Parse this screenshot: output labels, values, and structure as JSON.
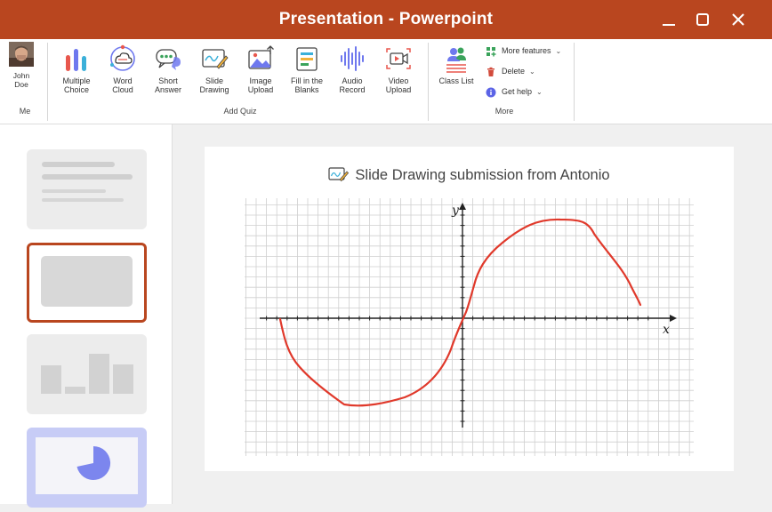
{
  "window": {
    "title": "Presentation - Powerpoint",
    "controls": [
      "minimize",
      "maximize",
      "close"
    ]
  },
  "ribbon": {
    "user": {
      "first_name": "John",
      "last_name": "Doe",
      "group_label": "Me"
    },
    "add_quiz": {
      "group_label": "Add Quiz",
      "tools": [
        {
          "line1": "Multiple",
          "line2": "Choice",
          "icon": "bar-chart-icon"
        },
        {
          "line1": "Word",
          "line2": "Cloud",
          "icon": "word-cloud-icon"
        },
        {
          "line1": "Short",
          "line2": "Answer",
          "icon": "chat-bubbles-icon"
        },
        {
          "line1": "Slide",
          "line2": "Drawing",
          "icon": "slide-drawing-icon"
        },
        {
          "line1": "Image",
          "line2": "Upload",
          "icon": "image-upload-icon"
        },
        {
          "line1": "Fill in the",
          "line2": "Blanks",
          "icon": "fill-blanks-icon"
        },
        {
          "line1": "Audio",
          "line2": "Record",
          "icon": "audio-wave-icon"
        },
        {
          "line1": "Video",
          "line2": "Upload",
          "icon": "video-upload-icon"
        }
      ]
    },
    "more": {
      "group_label": "More",
      "class_list": "Class List",
      "items": [
        {
          "label": "More features",
          "icon": "grid-plus-icon",
          "color": "#3aa35b"
        },
        {
          "label": "Delete",
          "icon": "trash-icon",
          "color": "#d24b3c"
        },
        {
          "label": "Get help",
          "icon": "info-icon",
          "color": "#5b63e6"
        }
      ]
    }
  },
  "slide": {
    "title": "Slide Drawing submission from Antonio",
    "axis_x": "x",
    "axis_y": "y"
  },
  "colors": {
    "accent": "#b9461f",
    "drawing_stroke": "#e0392b",
    "thumb_purple": "#c7ccf6",
    "thumb_shape": "#7c86ee"
  }
}
